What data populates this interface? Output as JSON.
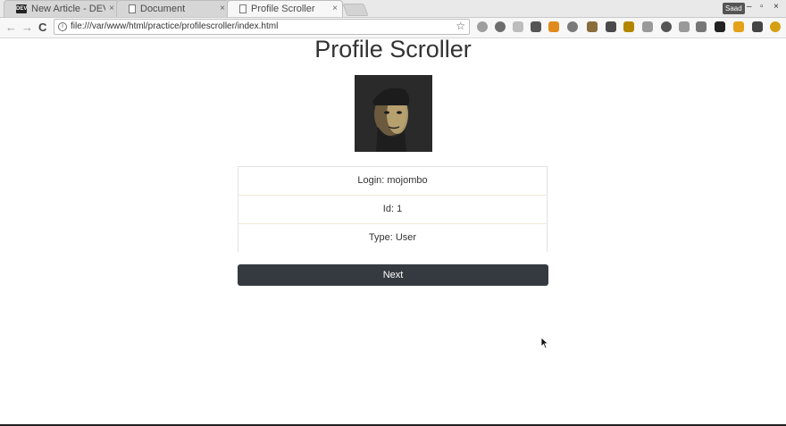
{
  "browser": {
    "tabs": [
      {
        "title": "New Article - DEV",
        "favicon": "dev-icon",
        "active": false
      },
      {
        "title": "Document",
        "favicon": "document-icon",
        "active": false
      },
      {
        "title": "Profile Scroller",
        "favicon": "document-icon",
        "active": true
      }
    ],
    "tab_close_glyph": "×",
    "profile_chip": "Saad",
    "window_controls": {
      "minimize": "–",
      "maximize": "▫",
      "close": "×"
    },
    "nav": {
      "back": "←",
      "forward": "→",
      "reload": "C"
    },
    "url": "file:///var/www/html/practice/profilescroller/index.html",
    "info_glyph": "i",
    "bookmark_star": "☆"
  },
  "page": {
    "title": "Profile Scroller",
    "avatar_icon": "profile-photo",
    "profile": [
      {
        "label": "Login: mojombo"
      },
      {
        "label": "Id: 1"
      },
      {
        "label": "Type: User"
      }
    ],
    "next_button": "Next"
  },
  "colors": {
    "button_bg": "#343a40",
    "title_text": "#333333",
    "row_divider": "#f0ead8"
  }
}
